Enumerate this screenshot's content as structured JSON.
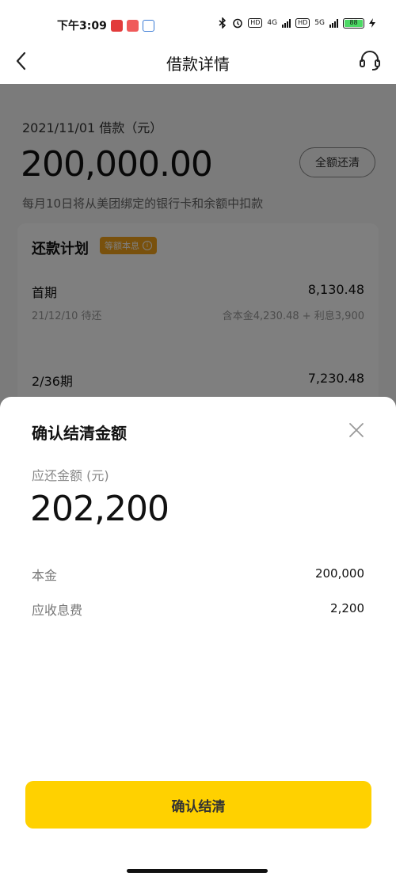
{
  "status_bar": {
    "time": "下午3:09",
    "net_4g": "4G",
    "net_5g": "5G",
    "hd": "HD",
    "battery": "88"
  },
  "nav": {
    "title": "借款详情",
    "back_icon": "chevron-left-icon",
    "service_icon": "headset-icon"
  },
  "loan": {
    "date_label": "2021/11/01 借款（元）",
    "amount": "200,000.00",
    "payoff_button": "全额还清",
    "note": "每月10日将从美团绑定的银行卡和余额中扣款"
  },
  "plan": {
    "title": "还款计划",
    "badge": "等额本息",
    "rows": [
      {
        "title": "首期",
        "amount": "8,130.48",
        "sub_left": "21/12/10 待还",
        "sub_right": "含本金4,230.48 + 利息3,900"
      },
      {
        "title": "2/36期",
        "amount": "7,230.48"
      }
    ]
  },
  "sheet": {
    "title": "确认结清金额",
    "due_label": "应还金额 (元)",
    "due_amount": "202,200",
    "details": [
      {
        "label": "本金",
        "value": "200,000"
      },
      {
        "label": "应收息费",
        "value": "2,200"
      }
    ],
    "confirm_button": "确认结清"
  },
  "colors": {
    "accent_yellow": "#ffd100",
    "badge_orange": "#f3a31b",
    "battery_green": "#4cd964"
  }
}
